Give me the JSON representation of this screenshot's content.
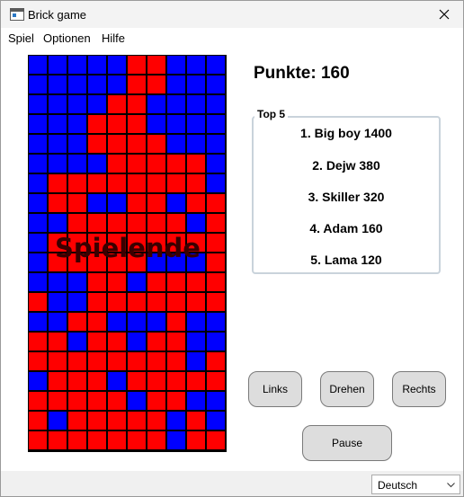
{
  "window": {
    "title": "Brick game",
    "close_icon": "close-icon"
  },
  "menu": {
    "items": [
      "Spiel",
      "Optionen",
      "Hilfe"
    ]
  },
  "colors": {
    "red": "#ff0000",
    "blue": "#0000ff",
    "grid": "#000000"
  },
  "board": {
    "rows": [
      "BBBBBRRBBB",
      "BBBBBRRBBB",
      "BBBBRRBBBB",
      "BBBRRRBBBB",
      "BBBRRRRBBB",
      "BBBBRRRRRB",
      "BRRRRRRRRB",
      "BRRBBRRBRR",
      "BBRRRRRRBR",
      "BRRRRRRRRR",
      "BRRRRRBBBR",
      "BBBRRBRRRR",
      "RBBRRRRRRR",
      "BBRRBBBRBB",
      "RRBRRBRRBB",
      "RRRRRRRRBR",
      "BRRRBRRRRR",
      "RRRRRBRRBB",
      "RBRRRRRBRB",
      "RRRRRRRBRR"
    ],
    "overlay_text": "Spielende"
  },
  "score": {
    "label": "Punkte: 160"
  },
  "top5": {
    "legend": "Top 5",
    "entries": [
      "1. Big boy  1400",
      "2. Dejw  380",
      "3. Skiller  320",
      "4. Adam  160",
      "5. Lama  120"
    ]
  },
  "controls": {
    "left": "Links",
    "rotate": "Drehen",
    "right": "Rechts",
    "pause": "Pause"
  },
  "language": {
    "selected": "Deutsch"
  }
}
